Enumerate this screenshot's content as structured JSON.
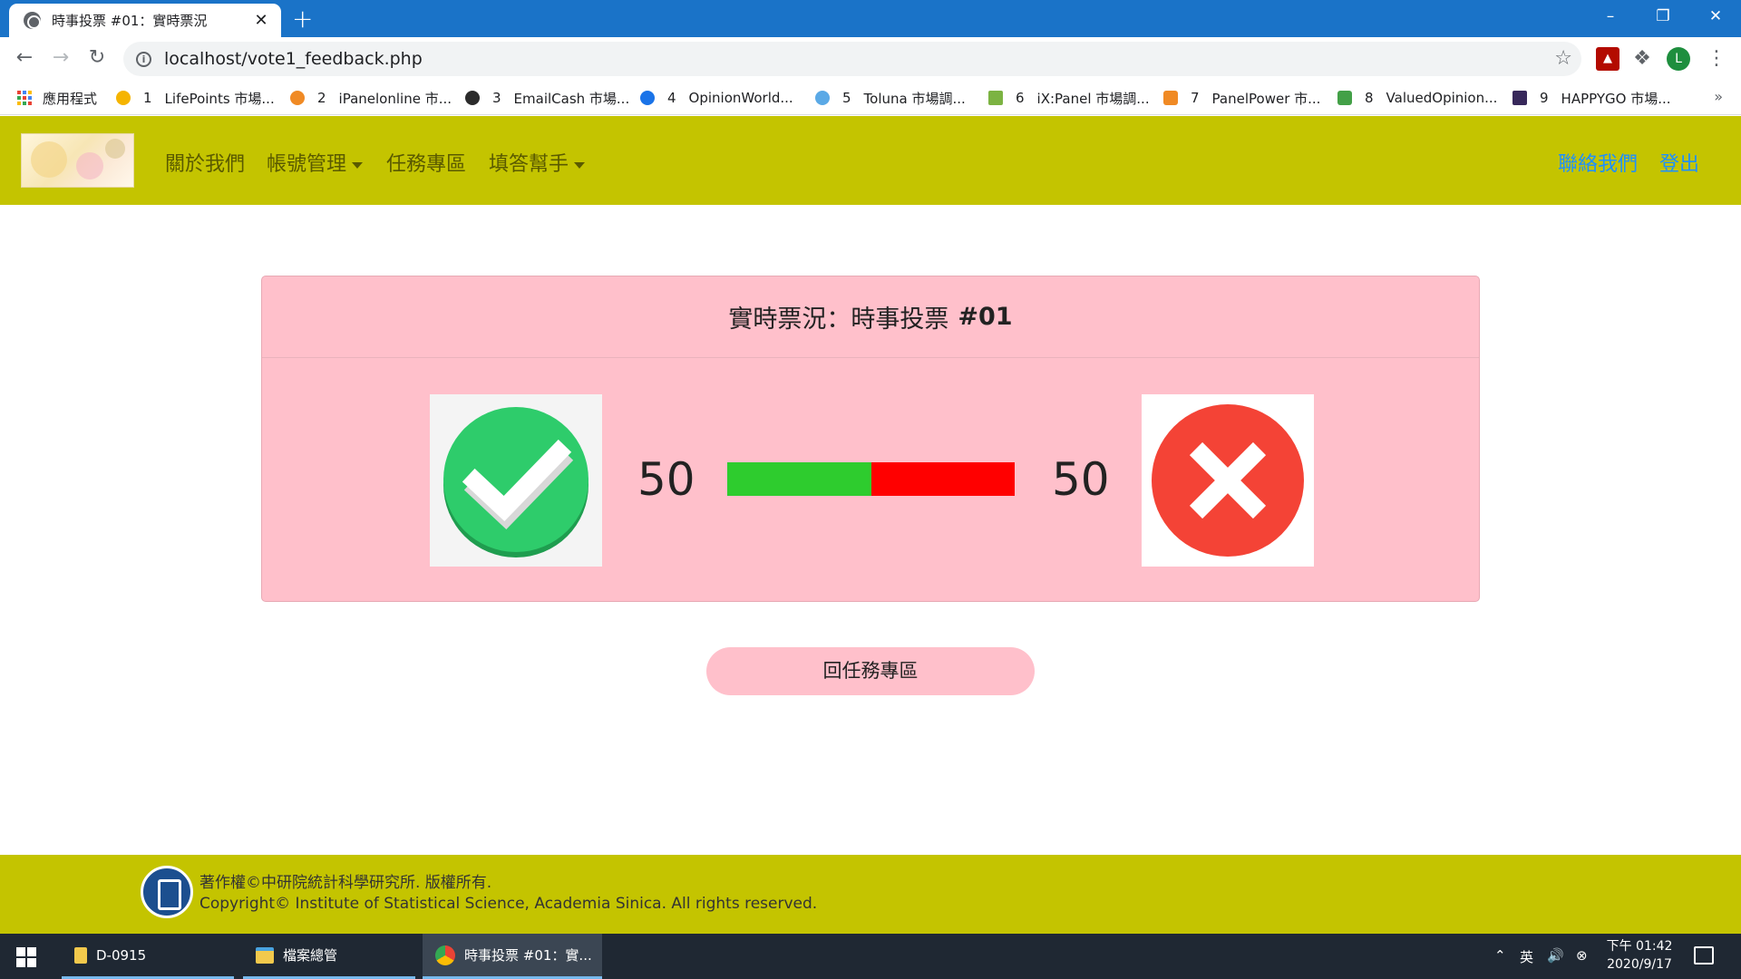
{
  "browser": {
    "tab_title": "時事投票 #01：實時票況",
    "tab_close": "✕",
    "new_tab": "+",
    "url": "localhost/vote1_feedback.php",
    "profile_initial": "L",
    "bookmarks": [
      {
        "num": "",
        "label": "應用程式",
        "color": "#e94235"
      },
      {
        "num": "1",
        "label": "LifePoints 市場...",
        "color": "#f5b400"
      },
      {
        "num": "2",
        "label": "iPanelonline 市...",
        "color": "#f08a24"
      },
      {
        "num": "3",
        "label": "EmailCash 市場...",
        "color": "#2b2b2b"
      },
      {
        "num": "4",
        "label": "OpinionWorld...",
        "color": "#1a73e8"
      },
      {
        "num": "5",
        "label": "Toluna 市場調...",
        "color": "#5aa9e6"
      },
      {
        "num": "6",
        "label": "iX:Panel 市場調...",
        "color": "#7cb342"
      },
      {
        "num": "7",
        "label": "PanelPower 市...",
        "color": "#f08a24"
      },
      {
        "num": "8",
        "label": "ValuedOpinion...",
        "color": "#43a047"
      },
      {
        "num": "9",
        "label": "HAPPYGO 市場...",
        "color": "#37285a"
      }
    ],
    "bookmarks_more": "»"
  },
  "nav": {
    "about": "關於我們",
    "account": "帳號管理",
    "tasks": "任務專區",
    "helper": "填答幫手",
    "contact": "聯絡我們",
    "logout": "登出"
  },
  "vote": {
    "title": "實時票況：時事投票",
    "number": "#01",
    "yes_count": "50",
    "no_count": "50",
    "yes_share": 0.5,
    "yes_color": "#2ecc2e",
    "no_color": "#ff0000"
  },
  "back_button": "回任務專區",
  "footer": {
    "line1": "著作權©中研院統計科學研究所. 版權所有.",
    "line2": "Copyright© Institute of Statistical Science, Academia Sinica. All rights reserved."
  },
  "taskbar": {
    "items": [
      {
        "label": "D-0915"
      },
      {
        "label": "檔案總管"
      },
      {
        "label": "時事投票 #01：實..."
      }
    ],
    "ime": "英",
    "time": "下午 01:42",
    "date": "2020/9/17"
  },
  "colors": {
    "accent_bar": "#c4c400",
    "card": "#ffc0cb",
    "link_blue": "#1e90ff"
  }
}
